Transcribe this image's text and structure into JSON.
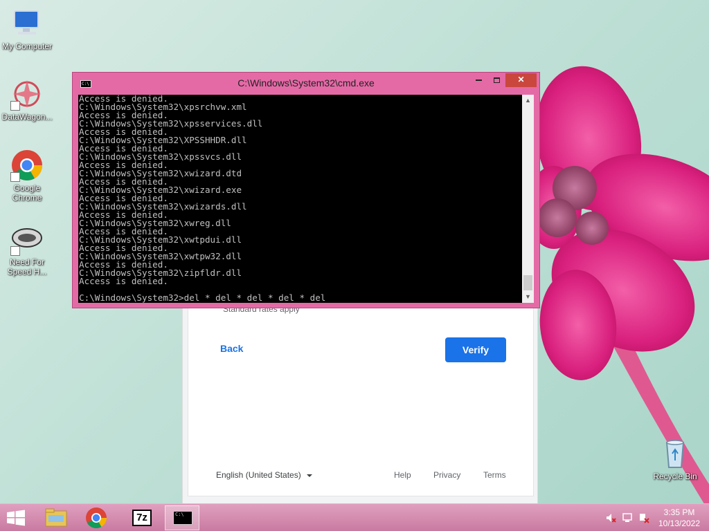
{
  "desktop": {
    "icons": [
      {
        "label": "My Computer"
      },
      {
        "label": "DataWagon..."
      },
      {
        "label": "Google Chrome"
      },
      {
        "label": "Need For Speed H..."
      },
      {
        "label": "Recycle Bin"
      }
    ]
  },
  "cmd": {
    "title": "C:\\Windows\\System32\\cmd.exe",
    "icon_label": "C:\\",
    "lines": [
      "Access is denied.",
      "C:\\Windows\\System32\\xpsrchvw.xml",
      "Access is denied.",
      "C:\\Windows\\System32\\xpsservices.dll",
      "Access is denied.",
      "C:\\Windows\\System32\\XPSSHHDR.dll",
      "Access is denied.",
      "C:\\Windows\\System32\\xpssvcs.dll",
      "Access is denied.",
      "C:\\Windows\\System32\\xwizard.dtd",
      "Access is denied.",
      "C:\\Windows\\System32\\xwizard.exe",
      "Access is denied.",
      "C:\\Windows\\System32\\xwizards.dll",
      "Access is denied.",
      "C:\\Windows\\System32\\xwreg.dll",
      "Access is denied.",
      "C:\\Windows\\System32\\xwtpdui.dll",
      "Access is denied.",
      "C:\\Windows\\System32\\xwtpw32.dll",
      "Access is denied.",
      "C:\\Windows\\System32\\zipfldr.dll",
      "Access is denied.",
      "",
      "C:\\Windows\\System32>del * del * del * del * del"
    ],
    "buttons": {
      "close": "✕"
    }
  },
  "google_page": {
    "rates_text": "Standard rates apply",
    "back_label": "Back",
    "verify_label": "Verify",
    "language": "English (United States)",
    "footer_links": {
      "help": "Help",
      "privacy": "Privacy",
      "terms": "Terms"
    }
  },
  "taskbar": {
    "apps": [
      {
        "icon": "file-explorer-icon"
      },
      {
        "icon": "chrome-icon"
      },
      {
        "icon": "7zip-icon",
        "label": "7z"
      },
      {
        "icon": "cmd-icon",
        "label": "C:\\",
        "active": true
      }
    ],
    "tray": [
      "volume-muted-icon",
      "network-icon",
      "action-center-icon"
    ],
    "time": "3:35 PM",
    "date": "10/13/2022"
  },
  "colors": {
    "accent": "#1a73e8",
    "window_frame": "#e46aa6",
    "close_button": "#c9473d",
    "console_bg": "#000000",
    "console_text": "#c0c0c0"
  }
}
